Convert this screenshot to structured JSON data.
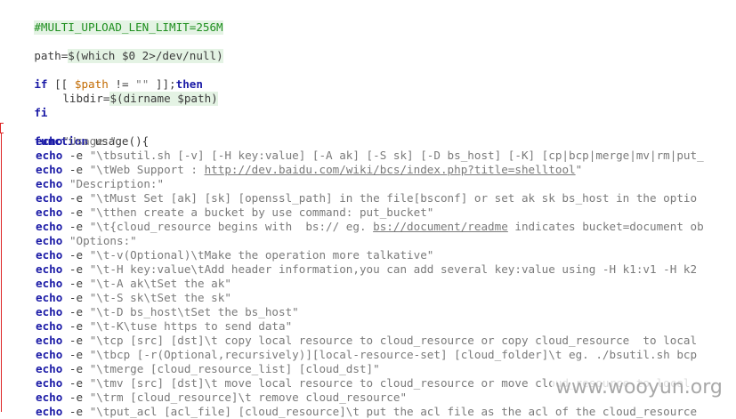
{
  "editor": {
    "line1": {
      "text": "#MULTI_UPLOAD_LEN_LIMIT=256M"
    },
    "line3": {
      "var": "path",
      "assign": "=",
      "subst": "$(which $0 2>/dev/null)"
    },
    "line5": {
      "kw_if": "if",
      "open": " [[ ",
      "var": "$path",
      "cmp": " != ",
      "str": "\"\"",
      "close": " ]];",
      "kw_then": "then"
    },
    "line6": {
      "var": "libdir",
      "assign": "=",
      "subst": "$(dirname $path)"
    },
    "line7": {
      "kw": "fi"
    },
    "line9": {
      "kw": "function",
      "rest": " usage(){"
    },
    "usage_lines": [
      {
        "cmd": "echo",
        "flag": "",
        "str": "\"Usage:\""
      },
      {
        "cmd": "echo",
        "flag": " -e ",
        "str": "\"\\tbsutil.sh [-v] [-H key:value] [-A ak] [-S sk] [-D bs_host] [-K] [cp|bcp|merge|mv|rm|put_"
      },
      {
        "cmd": "echo",
        "flag": " -e ",
        "pre": "\"\\tWeb Support : ",
        "link": "http://dev.baidu.com/wiki/bcs/index.php?title=shelltool",
        "post": "\""
      },
      {
        "cmd": "echo",
        "flag": " ",
        "str": "\"Description:\""
      },
      {
        "cmd": "echo",
        "flag": " -e ",
        "str": "\"\\tMust Set [ak] [sk] [openssl_path] in the file[bsconf] or set ak sk bs_host in the optio"
      },
      {
        "cmd": "echo",
        "flag": " -e ",
        "str": "\"\\tthen create a bucket by use command: put_bucket\""
      },
      {
        "cmd": "echo",
        "flag": " -e ",
        "pre": "\"\\t{cloud_resource begins with  bs:// eg. ",
        "link": "bs://document/readme",
        "post": " indicates bucket=document ob"
      },
      {
        "cmd": "echo",
        "flag": " ",
        "str": "\"Options:\""
      },
      {
        "cmd": "echo",
        "flag": " -e ",
        "str": "\"\\t-v(Optional)\\tMake the operation more talkative\""
      },
      {
        "cmd": "echo",
        "flag": " -e ",
        "str": "\"\\t-H key:value\\tAdd header information,you can add several key:value using -H k1:v1 -H k2"
      },
      {
        "cmd": "echo",
        "flag": " -e ",
        "str": "\"\\t-A ak\\tSet the ak\""
      },
      {
        "cmd": "echo",
        "flag": " -e ",
        "str": "\"\\t-S sk\\tSet the sk\""
      },
      {
        "cmd": "echo",
        "flag": " -e ",
        "str": "\"\\t-D bs_host\\tSet the bs_host\""
      },
      {
        "cmd": "echo",
        "flag": " -e ",
        "str": "\"\\t-K\\tuse https to send data\""
      },
      {
        "cmd": "echo",
        "flag": " -e ",
        "str": "\"\\tcp [src] [dst]\\t copy local resource to cloud_resource or copy cloud_resource  to local"
      },
      {
        "cmd": "echo",
        "flag": " -e ",
        "str": "\"\\tbcp [-r(Optional,recursively)][local-resource-set] [cloud_folder]\\t eg. ./bsutil.sh bcp"
      },
      {
        "cmd": "echo",
        "flag": " -e ",
        "str": "\"\\tmerge [cloud_resource_list] [cloud_dst]\""
      },
      {
        "cmd": "echo",
        "flag": " -e ",
        "str": "\"\\tmv [src] [dst]\\t move local resource to cloud_resource or move cloud_resource to local"
      },
      {
        "cmd": "echo",
        "flag": " -e ",
        "str": "\"\\trm [cloud_resource]\\t remove cloud_resource\""
      },
      {
        "cmd": "echo",
        "flag": " -e ",
        "str": "\"\\tput_acl [acl_file] [cloud_resource]\\t put the acl file as the acl of the cloud_resource"
      }
    ]
  },
  "watermark": "www.wooyun.org"
}
